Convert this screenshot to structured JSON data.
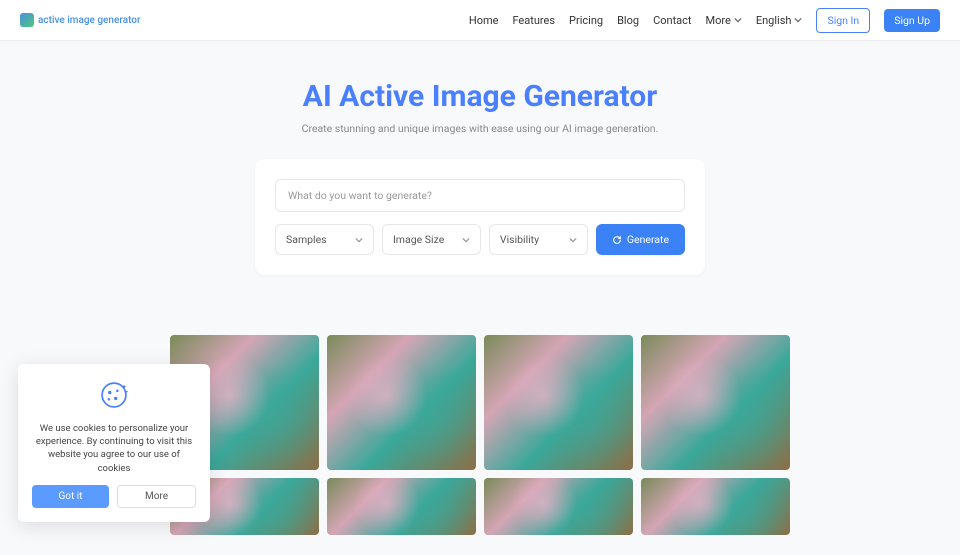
{
  "logo": {
    "text": "active image generator"
  },
  "nav": {
    "home": "Home",
    "features": "Features",
    "pricing": "Pricing",
    "blog": "Blog",
    "contact": "Contact",
    "more": "More",
    "language": "English",
    "signin": "Sign In",
    "signup": "Sign Up"
  },
  "hero": {
    "title": "AI Active Image Generator",
    "subtitle": "Create stunning and unique images with ease using our AI image generation."
  },
  "prompt": {
    "placeholder": "What do you want to generate?",
    "samples": "Samples",
    "imagesize": "Image Size",
    "visibility": "Visibility",
    "generate": "Generate"
  },
  "cookie": {
    "text": "We use cookies to personalize your experience. By continuing to visit this website you agree to our use of cookies",
    "gotit": "Got it",
    "more": "More"
  }
}
